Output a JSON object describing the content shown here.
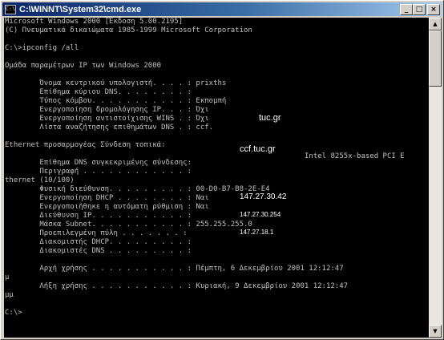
{
  "window": {
    "title": "C:\\WINNT\\System32\\cmd.exe",
    "icon_label": "C:\\",
    "minimize_glyph": "_",
    "maximize_glyph": "□",
    "close_glyph": "×"
  },
  "console": {
    "lines": [
      "Microsoft Windows 2000 [Έκδοση 5.00.2195]",
      "(C) Πνευματικά δικαιώματα 1985-1999 Microsoft Corporation",
      "",
      "C:\\>ipconfig /all",
      "",
      "Ομάδα παραμέτρων IP των Windows 2000",
      "",
      "        Όνομα κεντρικού υπολογιστή. . . . : prixths",
      "        Επίθημα κύριου DNS. . . . . . . . :",
      "        Τύπος κόμβου. . . . . . . . . . . : Εκπομπή",
      "        Ενεργοποίηση δρομολόγησης IP. . . : Όχι",
      "        Ενεργοποίηση αντιστοίχισης WINS . : Όχι",
      "        Λίστα αναζήτησης επιθημάτων DNS . : ccf.",
      "",
      "Ethernet προσαρμογέας Σύνδεση τοπικά:",
      "",
      "        Επίθημα DNS συγκεκριμένης σύνδεσης:",
      "        Περιγραφή . . . . . . . . . . . . :",
      "thernet (10/100)",
      "        Φυσική διεύθυνση. . . . . . . . . : 00-D0-B7-B8-2E-E4",
      "        Ενεργοποίηση DHCP . . . . . . . . : Ναι",
      "        Ενεργοποιήθηκε η αυτόματη ρύθμιση : Ναι",
      "        Διεύθυνση IP. . . . . . . . . . . :",
      "        Μάσκα Subnet. . . . . . . . . . . : 255.255.255.0",
      "        Προεπιλεγμένη πύλη . . . . . . . :",
      "        Διακομιστής DHCP. . . . . . . . . :",
      "        Διακομιστές DNS . . . . . . . . . :",
      "",
      "        Αρχή χρήσης . . . . . . . . . . . : Πέμπτη, 6 Δεκεμβρίου 2001 12:12:47",
      "μ",
      "        Λήξη χρήσης . . . . . . . . . . . : Κυριακή, 9 Δεκεμβρίου 2001 12:12:47",
      "μμ",
      "",
      "C:\\>"
    ],
    "dns_suffix_search_tail": "tuc.gr",
    "connection_dns_suffix": "ccf.tuc.gr",
    "description_value": "Intel 8255x-based PCI E",
    "ip_address": "147.27.30.42",
    "default_gateway": "147.27.30.254",
    "dns_server": "147.27.18.1"
  },
  "scrollbar": {
    "up_glyph": "▲",
    "down_glyph": "▼"
  }
}
